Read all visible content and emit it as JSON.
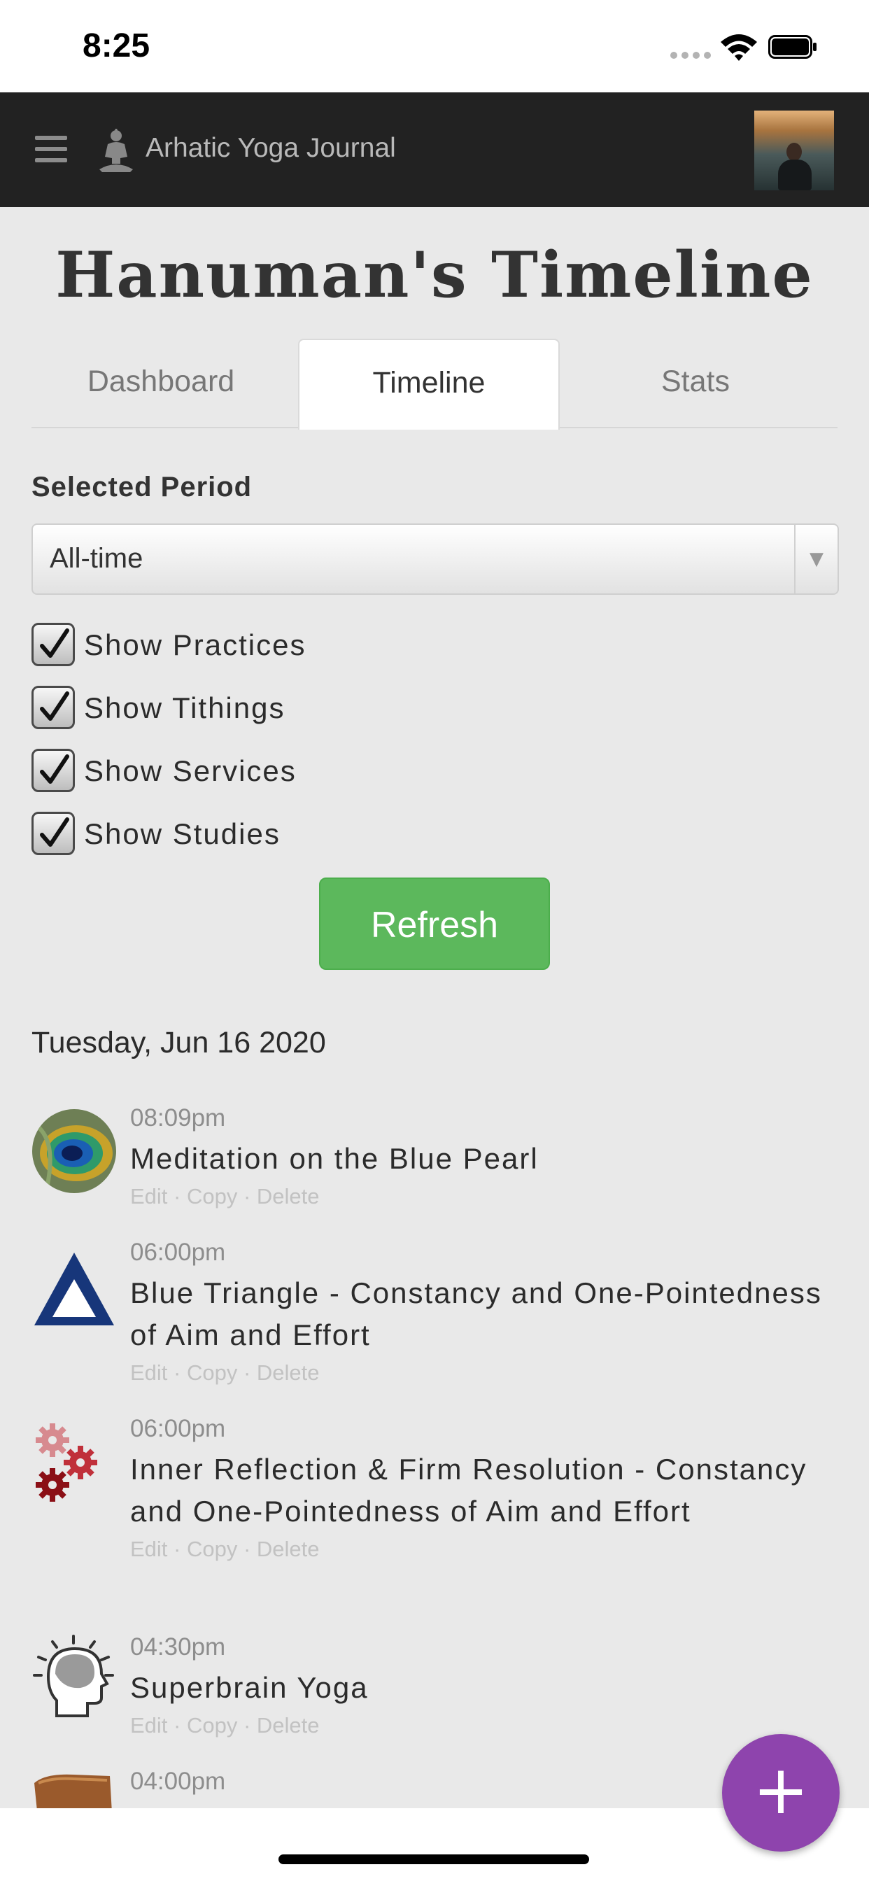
{
  "status_bar": {
    "time": "8:25"
  },
  "app_bar": {
    "title": "Arhatic Yoga Journal"
  },
  "page": {
    "title": "Hanuman's Timeline"
  },
  "tabs": [
    {
      "label": "Dashboard",
      "active": false
    },
    {
      "label": "Timeline",
      "active": true
    },
    {
      "label": "Stats",
      "active": false
    }
  ],
  "filters": {
    "period_label": "Selected Period",
    "period_value": "All-time",
    "checkboxes": [
      {
        "label": "Show Practices",
        "checked": true
      },
      {
        "label": "Show Tithings",
        "checked": true
      },
      {
        "label": "Show Services",
        "checked": true
      },
      {
        "label": "Show Studies",
        "checked": true
      }
    ],
    "refresh_label": "Refresh"
  },
  "timeline": {
    "date": "Tuesday, Jun 16 2020",
    "entries": [
      {
        "time": "08:09pm",
        "title": "Meditation on the Blue Pearl",
        "icon": "peacock-feather-icon"
      },
      {
        "time": "06:00pm",
        "title": "Blue Triangle - Constancy and One-Pointedness of Aim and Effort",
        "icon": "blue-triangle-icon"
      },
      {
        "time": "06:00pm",
        "title": "Inner Reflection & Firm Resolution - Constancy and One-Pointedness of Aim and Effort",
        "icon": "gears-icon"
      },
      {
        "time": "04:30pm",
        "title": "Superbrain Yoga",
        "icon": "brain-head-icon"
      },
      {
        "time": "04:00pm",
        "title": "",
        "icon": "book-icon"
      }
    ],
    "actions": {
      "edit": "Edit",
      "copy": "Copy",
      "delete": "Delete",
      "separator": " · "
    }
  },
  "fab": {
    "label": "+"
  },
  "colors": {
    "refresh": "#5cb85c",
    "fab": "#8e44ad",
    "app_bar": "#222222"
  }
}
